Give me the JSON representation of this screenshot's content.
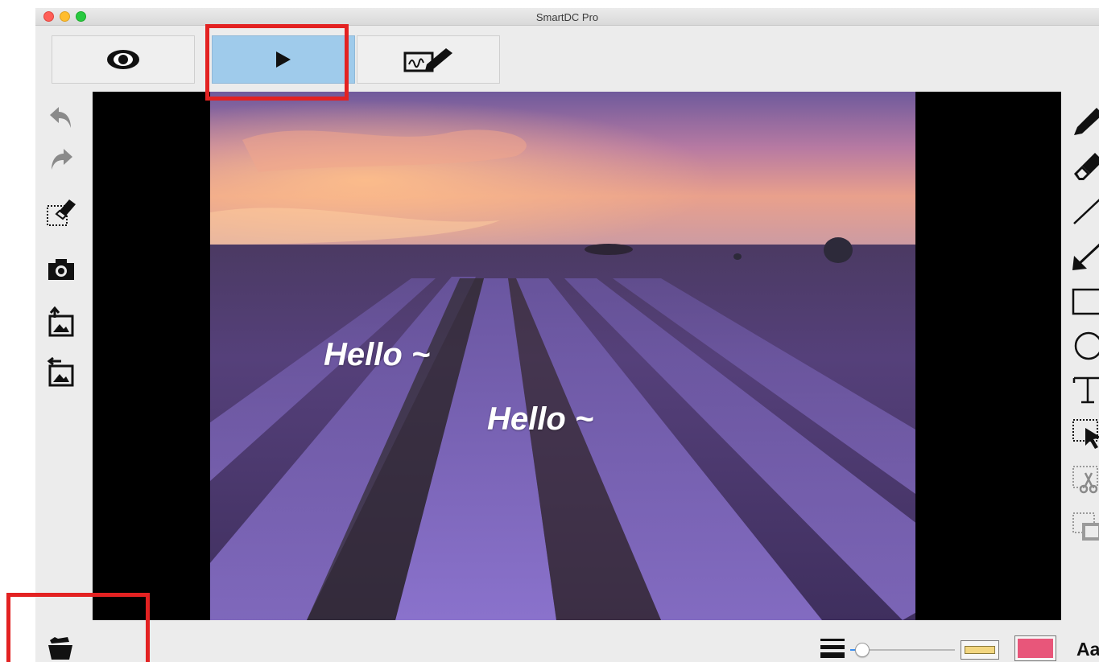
{
  "window": {
    "title": "SmartDC Pro"
  },
  "modes": [
    {
      "name": "view",
      "icon": "eye-icon",
      "active": false
    },
    {
      "name": "play",
      "icon": "play-icon",
      "active": true
    },
    {
      "name": "annotate",
      "icon": "signature-pen-icon",
      "active": false
    }
  ],
  "left_tools": [
    "undo-icon",
    "redo-icon",
    "erase-selection-icon",
    "camera-icon",
    "import-image-icon",
    "export-image-icon"
  ],
  "right_tools": [
    "pencil-icon",
    "eraser-icon",
    "line-icon",
    "arrow-icon",
    "rectangle-icon",
    "circle-icon",
    "text-icon",
    "select-icon",
    "cut-icon",
    "copy-icon"
  ],
  "canvas": {
    "texts": [
      "Hello ~",
      "Hello ~"
    ]
  },
  "bottom": {
    "folder_icon": "folder-open-icon",
    "line_width_icon": "line-width-icon",
    "slider_value": 0.05,
    "highlighter_color": "#f2d680",
    "pen_color": "#e8567a",
    "font_label": "Aa"
  },
  "colors": {
    "accent": "#9fcbeb",
    "highlight": "#e32222"
  }
}
